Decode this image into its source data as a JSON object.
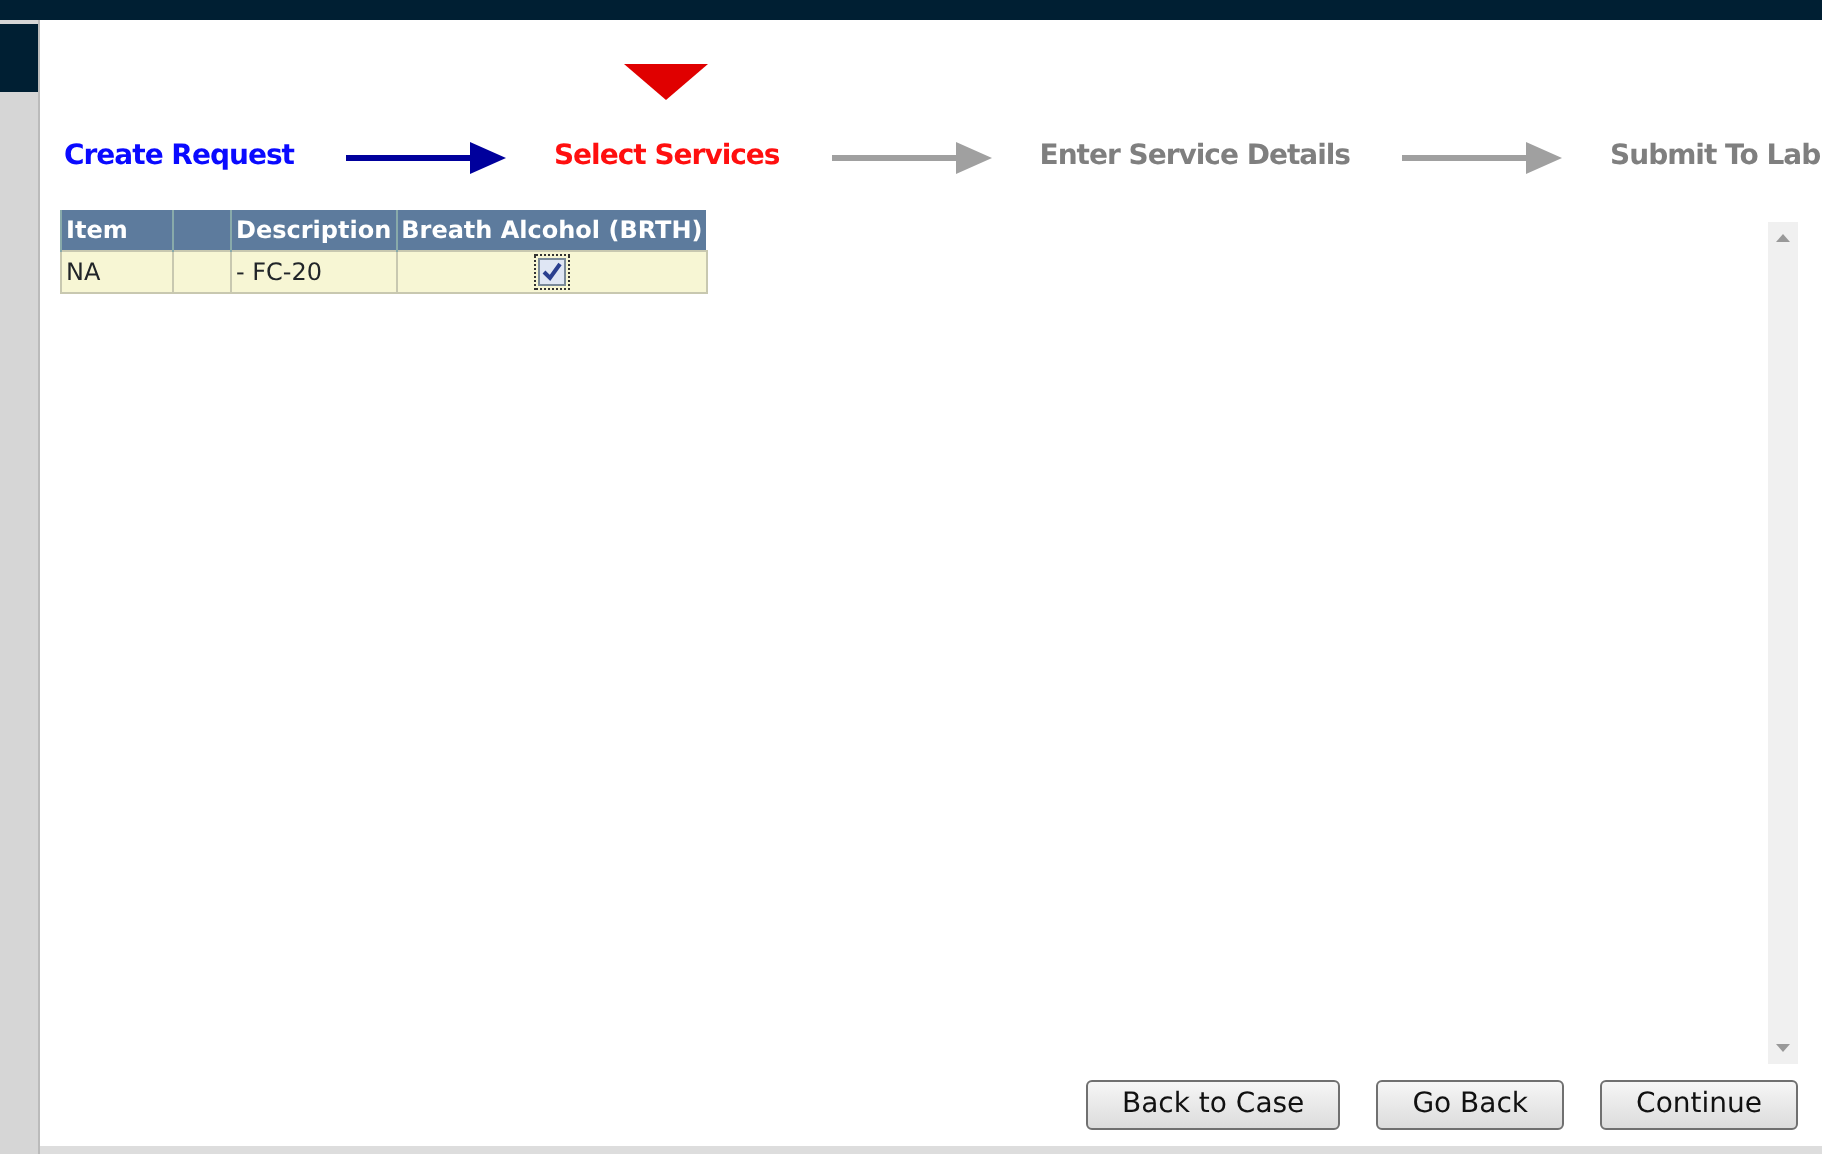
{
  "steps": [
    {
      "label": "Create Request",
      "completed": true,
      "selected": false
    },
    {
      "label": "Select Services",
      "completed": false,
      "selected": true
    },
    {
      "label": "Enter Service Details",
      "completed": false,
      "selected": false
    },
    {
      "label": "Submit To Lab",
      "completed": false,
      "selected": false
    }
  ],
  "table": {
    "columns": [
      "Item",
      "",
      "Description",
      "Breath Alcohol (BRTH)"
    ],
    "rows": [
      {
        "item": "NA",
        "column_2": "",
        "description": "- FC-20",
        "checked": true
      }
    ]
  },
  "buttons": [
    "Back to Case",
    "Go Back",
    "Continue"
  ]
}
